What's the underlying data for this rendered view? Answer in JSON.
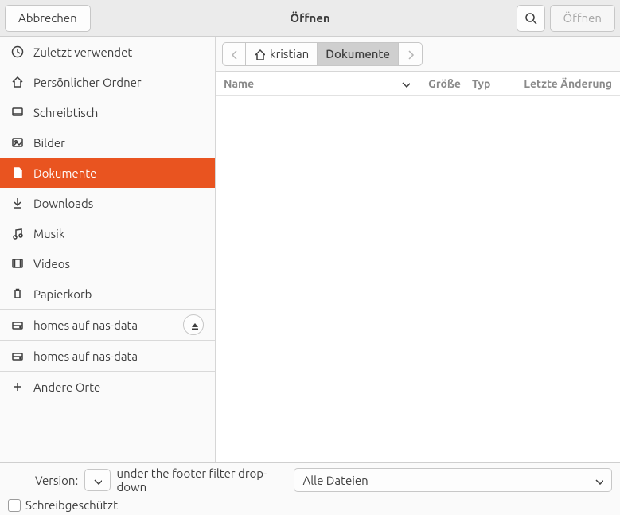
{
  "header": {
    "cancel": "Abbrechen",
    "title": "Öffnen",
    "open": "Öffnen"
  },
  "sidebar": {
    "items": [
      {
        "icon": "clock-icon",
        "label": "Zuletzt verwendet"
      },
      {
        "icon": "home-icon",
        "label": "Persönlicher Ordner"
      },
      {
        "icon": "desktop-icon",
        "label": "Schreibtisch"
      },
      {
        "icon": "pictures-icon",
        "label": "Bilder"
      },
      {
        "icon": "document-icon",
        "label": "Dokumente",
        "selected": true
      },
      {
        "icon": "download-icon",
        "label": "Downloads"
      },
      {
        "icon": "music-icon",
        "label": "Musik"
      },
      {
        "icon": "video-icon",
        "label": "Videos"
      },
      {
        "icon": "trash-icon",
        "label": "Papierkorb"
      }
    ],
    "mounts": [
      {
        "icon": "drive-icon",
        "label": "homes auf nas-data",
        "ejectable": true
      },
      {
        "icon": "drive-icon",
        "label": "homes auf nas-data"
      }
    ],
    "other": {
      "icon": "plus-icon",
      "label": "Andere Orte"
    }
  },
  "path": {
    "segments": [
      {
        "icon": "home-icon",
        "label": "kristian"
      },
      {
        "label": "Dokumente",
        "current": true
      }
    ]
  },
  "columns": {
    "name": "Name",
    "size": "Größe",
    "type": "Typ",
    "modified": "Letzte Änderung"
  },
  "footer": {
    "version_label": "Version:",
    "filetype_selected": "Alle Dateien",
    "readonly_label": "Schreibgeschützt"
  }
}
